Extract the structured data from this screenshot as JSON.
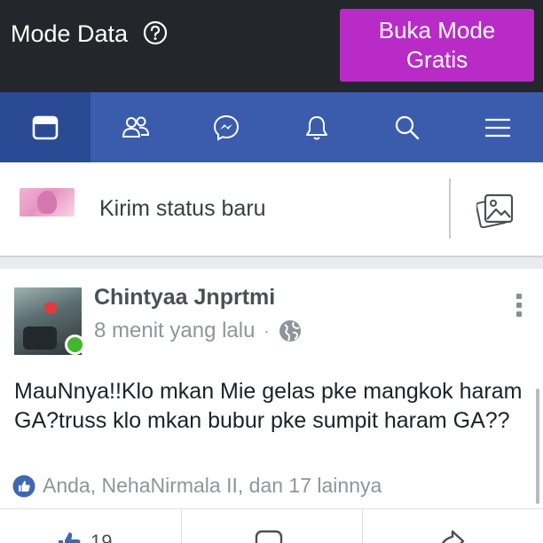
{
  "data_bar": {
    "title": "Mode Data",
    "free_button": {
      "line1": "Buka Mode",
      "line2": "Gratis"
    }
  },
  "nav": {
    "items": [
      {
        "icon": "news-feed-icon",
        "active": true
      },
      {
        "icon": "friends-icon",
        "active": false
      },
      {
        "icon": "messenger-icon",
        "active": false
      },
      {
        "icon": "notifications-bell-icon",
        "active": false
      },
      {
        "icon": "search-icon",
        "active": false
      },
      {
        "icon": "menu-icon",
        "active": false
      }
    ]
  },
  "composer": {
    "placeholder": "Kirim status baru"
  },
  "post": {
    "author": "Chintyaa Jnprtmi",
    "time": "8 menit yang lalu",
    "separator": "·",
    "text": "MauNnya!!Klo mkan Mie gelas pke mangkok haram GA?truss klo mkan bubur pke sumpit haram GA??",
    "reactions_text": "Anda, NehaNirmala II, dan 17 lainnya",
    "like_count": "19"
  },
  "colors": {
    "top_bar": "#23262b",
    "free_button": "#b92bc7",
    "nav": "#3b5cad",
    "nav_active": "#2b4a96",
    "online": "#42b72a",
    "like": "#4267b2"
  }
}
